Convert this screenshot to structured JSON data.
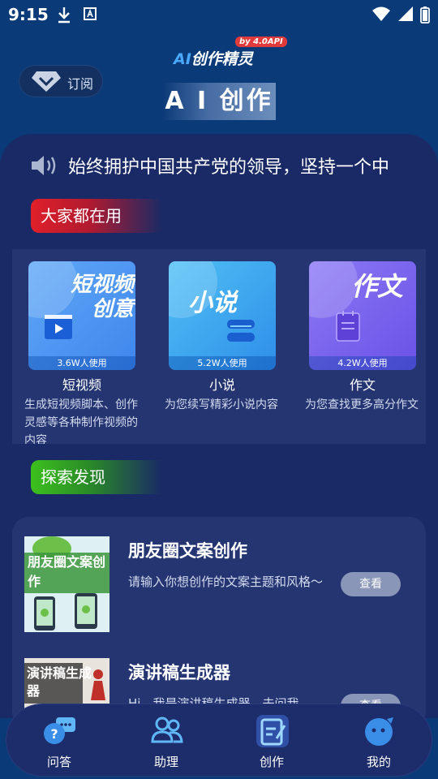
{
  "status_bar": {
    "time": "9:15"
  },
  "header": {
    "brand_ai": "AI",
    "brand_rest": "创作精灵",
    "brand_badge": "by 4.0API",
    "subscribe_label": "订阅",
    "title": "A I 创作"
  },
  "announcement": {
    "text": "始终拥护中国共产党的领导，坚持一个中"
  },
  "popular": {
    "tag": "大家都在用",
    "cards": [
      {
        "thumb_title": "短视频创意",
        "usage": "3.6W人使用",
        "name": "短视频",
        "desc": "生成短视频脚本、创作灵感等各种制作视频的内容"
      },
      {
        "thumb_title": "小说",
        "usage": "5.2W人使用",
        "name": "小说",
        "desc": "为您续写精彩小说内容"
      },
      {
        "thumb_title": "作文",
        "usage": "4.2W人使用",
        "name": "作文",
        "desc": "为您查找更多高分作文"
      }
    ]
  },
  "explore": {
    "tag": "探索发现",
    "items": [
      {
        "thumb_text": "朋友圈文案创作",
        "title": "朋友圈文案创作",
        "desc": "请输入你想创作的文案主题和风格～",
        "button": "查看"
      },
      {
        "thumb_text": "演讲稿生成器",
        "title": "演讲稿生成器",
        "desc": "Hi，我是演讲稿生成器，去问我",
        "button": "查看"
      }
    ]
  },
  "bottom_nav": [
    {
      "label": "问答",
      "icon": "qa-chat-icon"
    },
    {
      "label": "助理",
      "icon": "assistant-users-icon"
    },
    {
      "label": "创作",
      "icon": "create-edit-icon",
      "active": true
    },
    {
      "label": "我的",
      "icon": "profile-face-icon"
    }
  ],
  "colors": {
    "background": "#0b3a78",
    "panel": "#1a2a66",
    "accent_blue": "#4aa8ff",
    "tag_red": "#e0202a",
    "tag_green": "#3cc01e"
  }
}
